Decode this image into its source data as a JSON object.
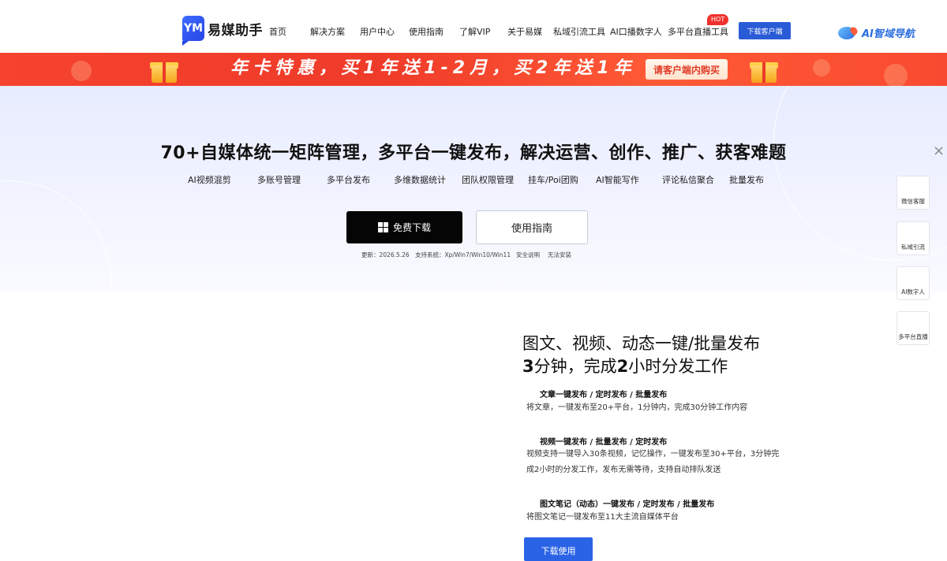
{
  "header": {
    "logo_text": "易媒助手",
    "nav": [
      "首页",
      "解决方案",
      "用户中心",
      "使用指南",
      "了解VIP",
      "关于易媒",
      "私域引流工具",
      "AI口播数字人",
      "多平台直播工具"
    ],
    "hot_badge": "HOT",
    "download_client": "下载客户端",
    "ai_nav": "AI智域导航"
  },
  "promo": {
    "text": "年卡特惠，买1年送1-2月，买2年送1年",
    "cta": "请客户端内购买"
  },
  "hero": {
    "title": "70+自媒体统一矩阵管理，多平台一键发布，解决运营、创作、推广、获客难题",
    "features": [
      "AI视频混剪",
      "多账号管理",
      "多平台发布",
      "多维数据统计",
      "团队权限管理",
      "挂车/Poi团购",
      "AI智能写作",
      "评论私信聚合",
      "批量发布"
    ],
    "free_download": "免费下载",
    "guide": "使用指南",
    "meta": [
      "更新：2026.5.26",
      "支持系统：Xp/Win7/Win10/Win11",
      "安全说明",
      "无法安装"
    ]
  },
  "side": [
    "微信客服",
    "私域引流",
    "AI数字人",
    "多平台直播"
  ],
  "close": "×",
  "section": {
    "title": "图文、视频、动态一键/批量发布",
    "sub_pre": "3",
    "sub_mid1": "分钟，完成",
    "sub_num2": "2",
    "sub_post": "小时分发工作",
    "items": [
      {
        "head": "文章一键发布 / 定时发布 / 批量发布",
        "desc": "将文章，一键发布至20+平台，1分钟内，完成30分钟工作内容"
      },
      {
        "head": "视频一键发布 / 批量发布 / 定时发布",
        "desc": "视频支持一键导入30条视频，记忆操作，一键发布至30+平台，3分钟完成2小时的分发工作，发布无需等待，支持自动排队发送"
      },
      {
        "head": "图文笔记（动态）一键发布 / 定时发布 / 批量发布",
        "desc": "将图文笔记一键发布至11大主流自媒体平台"
      }
    ],
    "cta": "下载使用"
  }
}
